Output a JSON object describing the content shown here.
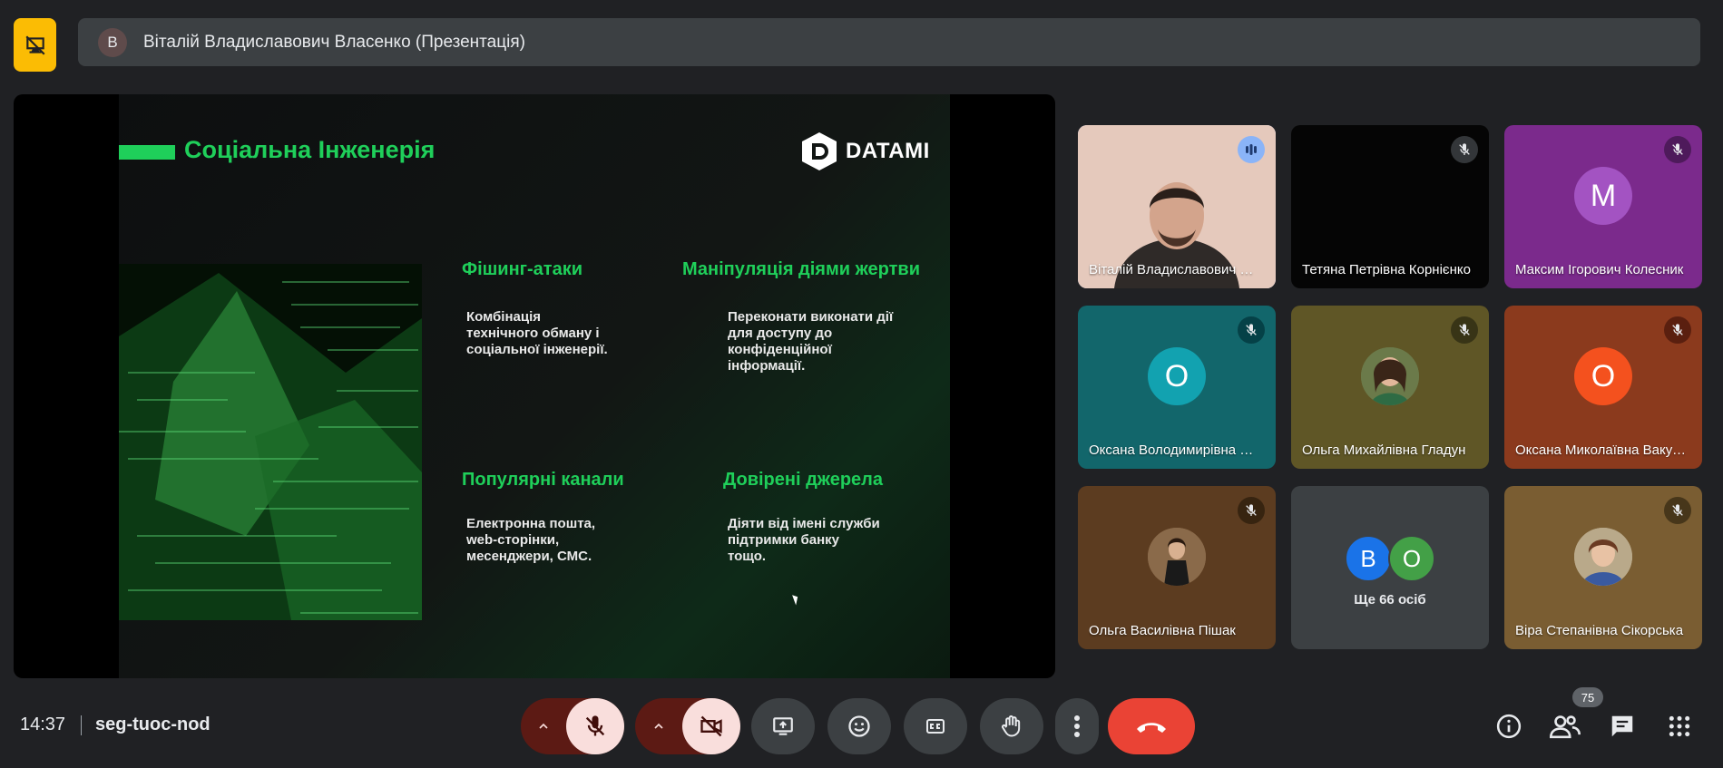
{
  "header": {
    "presenter_initial": "В",
    "title": "Віталій Владиславович Власенко (Презентація)"
  },
  "slide": {
    "title": "Соціальна Інженерія",
    "brand": "DATAMI",
    "cards": [
      {
        "heading": "Фішинг-атаки",
        "body": "Комбінація\nтехнічного обману і\nсоціальної інженерії."
      },
      {
        "heading": "Маніпуляція діями жертви",
        "body": "Переконати виконати дії\nдля доступу до\nконфіденційної\nінформації."
      },
      {
        "heading": "Популярні канали",
        "body": "Електронна пошта,\nweb-сторінки,\nмесенджери, СМС."
      },
      {
        "heading": "Довірені джерела",
        "body": "Діяти від імені служби\nпідтримки банку\nтощо."
      }
    ]
  },
  "participants": [
    {
      "name": "Віталій Владиславович Власенко",
      "initial": "",
      "bg": "#e5c9bc",
      "avatar_bg": "",
      "mic": "speaking"
    },
    {
      "name": "Тетяна Петрівна Корнієнко",
      "initial": "",
      "bg": "#050505",
      "avatar_bg": "",
      "mic": "muted"
    },
    {
      "name": "Максим Ігорович Колесник",
      "initial": "М",
      "bg": "#7b2a8c",
      "avatar_bg": "#a353c2",
      "mic": "muted"
    },
    {
      "name": "Оксана Володимирівна Коваль",
      "initial": "О",
      "bg": "#12666b",
      "avatar_bg": "#12a2b0",
      "mic": "muted"
    },
    {
      "name": "Ольга Михайлівна Гладун",
      "initial": "",
      "bg": "#5f5626",
      "avatar_bg": "#6b7a4a",
      "mic": "muted"
    },
    {
      "name": "Оксана Миколаївна Вакуленко",
      "initial": "О",
      "bg": "#8b3a1d",
      "avatar_bg": "#f4511e",
      "mic": "muted"
    },
    {
      "name": "Ольга Василівна Пішак",
      "initial": "",
      "bg": "#5c3c20",
      "avatar_bg": "#8a6a4a",
      "mic": "muted"
    },
    {
      "name": "Віра Степанівна Сікорська",
      "initial": "",
      "bg": "#7a5d32",
      "avatar_bg": "#b9a98a",
      "mic": "muted"
    }
  ],
  "more": {
    "initials": [
      "В",
      "О"
    ],
    "colors": [
      "#1a73e8",
      "#43a047"
    ],
    "label": "Ще 66 осіб"
  },
  "footer": {
    "time": "14:37",
    "meeting_code": "seg-tuoc-nod",
    "people_count": "75"
  }
}
